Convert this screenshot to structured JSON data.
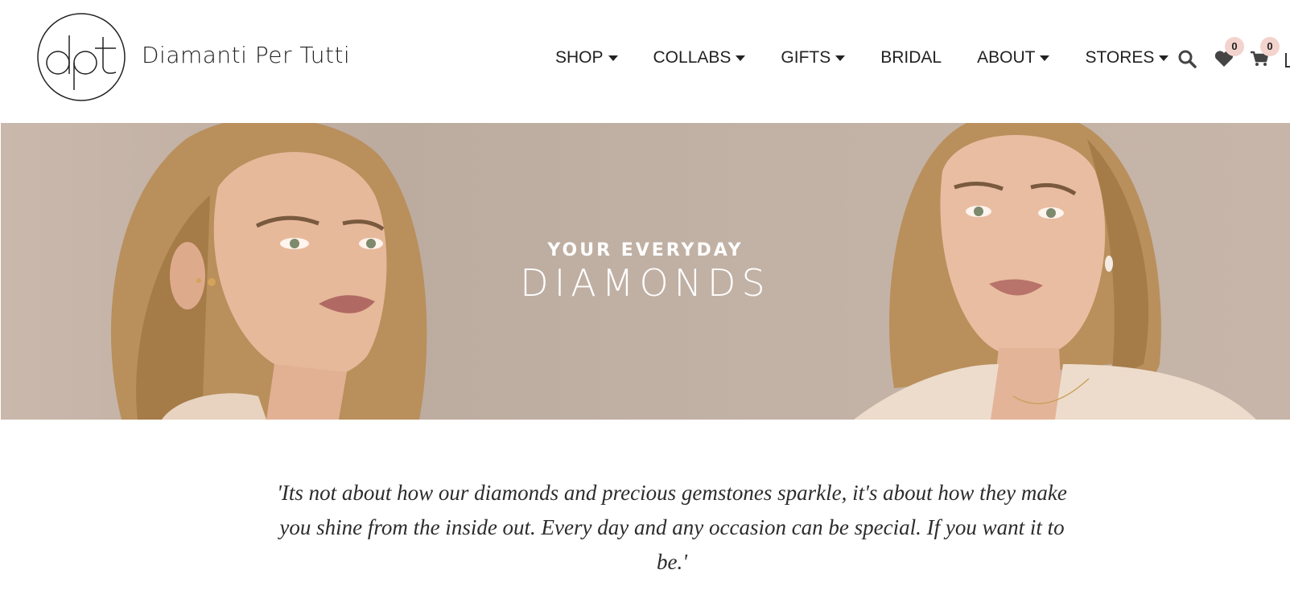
{
  "brand": {
    "name": "Diamanti Per Tutti",
    "monogram": "dpt",
    "logo_icon": "dpt-monogram-logo"
  },
  "nav": {
    "items": [
      {
        "label": "SHOP",
        "has_dropdown": true
      },
      {
        "label": "COLLABS",
        "has_dropdown": true
      },
      {
        "label": "GIFTS",
        "has_dropdown": true
      },
      {
        "label": "BRIDAL",
        "has_dropdown": false
      },
      {
        "label": "ABOUT",
        "has_dropdown": true
      },
      {
        "label": "STORES",
        "has_dropdown": true
      }
    ]
  },
  "header_icons": {
    "search_icon": "search-icon",
    "wishlist_icon": "heart-icon",
    "wishlist_count": "0",
    "cart_icon": "cart-icon",
    "cart_count": "0",
    "badge_color": "#f3d3cd"
  },
  "hero": {
    "kicker": "YOUR EVERYDAY",
    "title": "DIAMONDS",
    "background_color": "#c2b2a6"
  },
  "quote": {
    "text": "'Its not about how our diamonds and precious gemstones sparkle, it's about how they make you shine from the inside out. Every day and any occasion can be special. If you want it to be.'"
  }
}
